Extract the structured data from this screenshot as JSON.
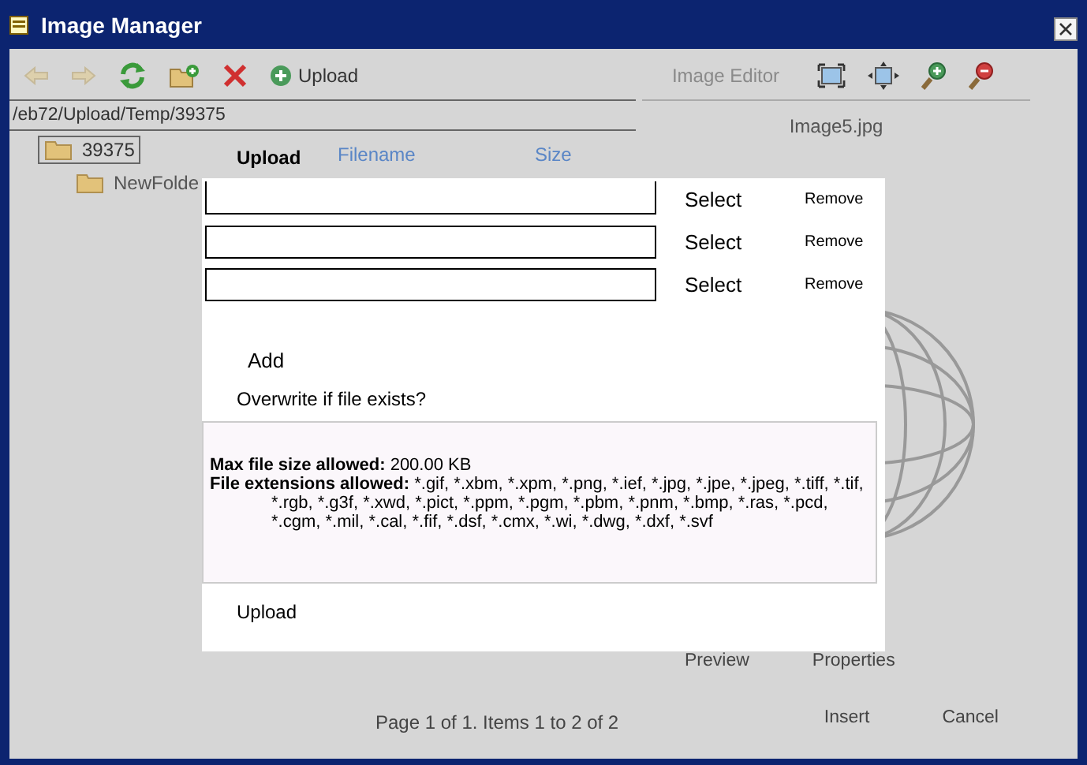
{
  "window": {
    "title": "Image Manager"
  },
  "toolbar": {
    "back": {
      "disabled": true
    },
    "forward": {
      "disabled": true
    },
    "upload": {
      "label": "Upload"
    },
    "image_editor": {
      "label": "Image Editor",
      "disabled": true
    }
  },
  "path": "/eb72/Upload/Temp/39375",
  "tree": [
    {
      "label": "39375",
      "selected": true,
      "children": [
        {
          "label": "NewFolde",
          "selected": false
        }
      ]
    }
  ],
  "grid": {
    "columns": [
      "Filename",
      "Size"
    ]
  },
  "preview": {
    "filename": "Image5.jpg"
  },
  "preview_tabs": [
    "Preview",
    "Properties"
  ],
  "pager": "Page 1 of 1. Items 1 to 2 of 2",
  "buttons": [
    "Insert",
    "Cancel"
  ],
  "upload_dialog": {
    "title": "Upload",
    "rows": [
      {
        "select": "Select",
        "remove": "Remove"
      },
      {
        "select": "Select",
        "remove": "Remove"
      },
      {
        "select": "Select",
        "remove": "Remove"
      }
    ],
    "add": "Add",
    "overwrite": "Overwrite if file exists?",
    "info": {
      "max_label": "Max file size allowed:",
      "max_value": "200.00 KB",
      "ext_label": "File extensions allowed:",
      "ext_value": "*.gif, *.xbm, *.xpm, *.png, *.ief, *.jpg, *.jpe, *.jpeg, *.tiff, *.tif, *.rgb, *.g3f, *.xwd, *.pict, *.ppm, *.pgm, *.pbm, *.pnm, *.bmp, *.ras, *.pcd, *.cgm, *.mil, *.cal, *.fif, *.dsf, *.cmx, *.wi, *.dwg, *.dxf, *.svf"
    },
    "submit": "Upload"
  }
}
